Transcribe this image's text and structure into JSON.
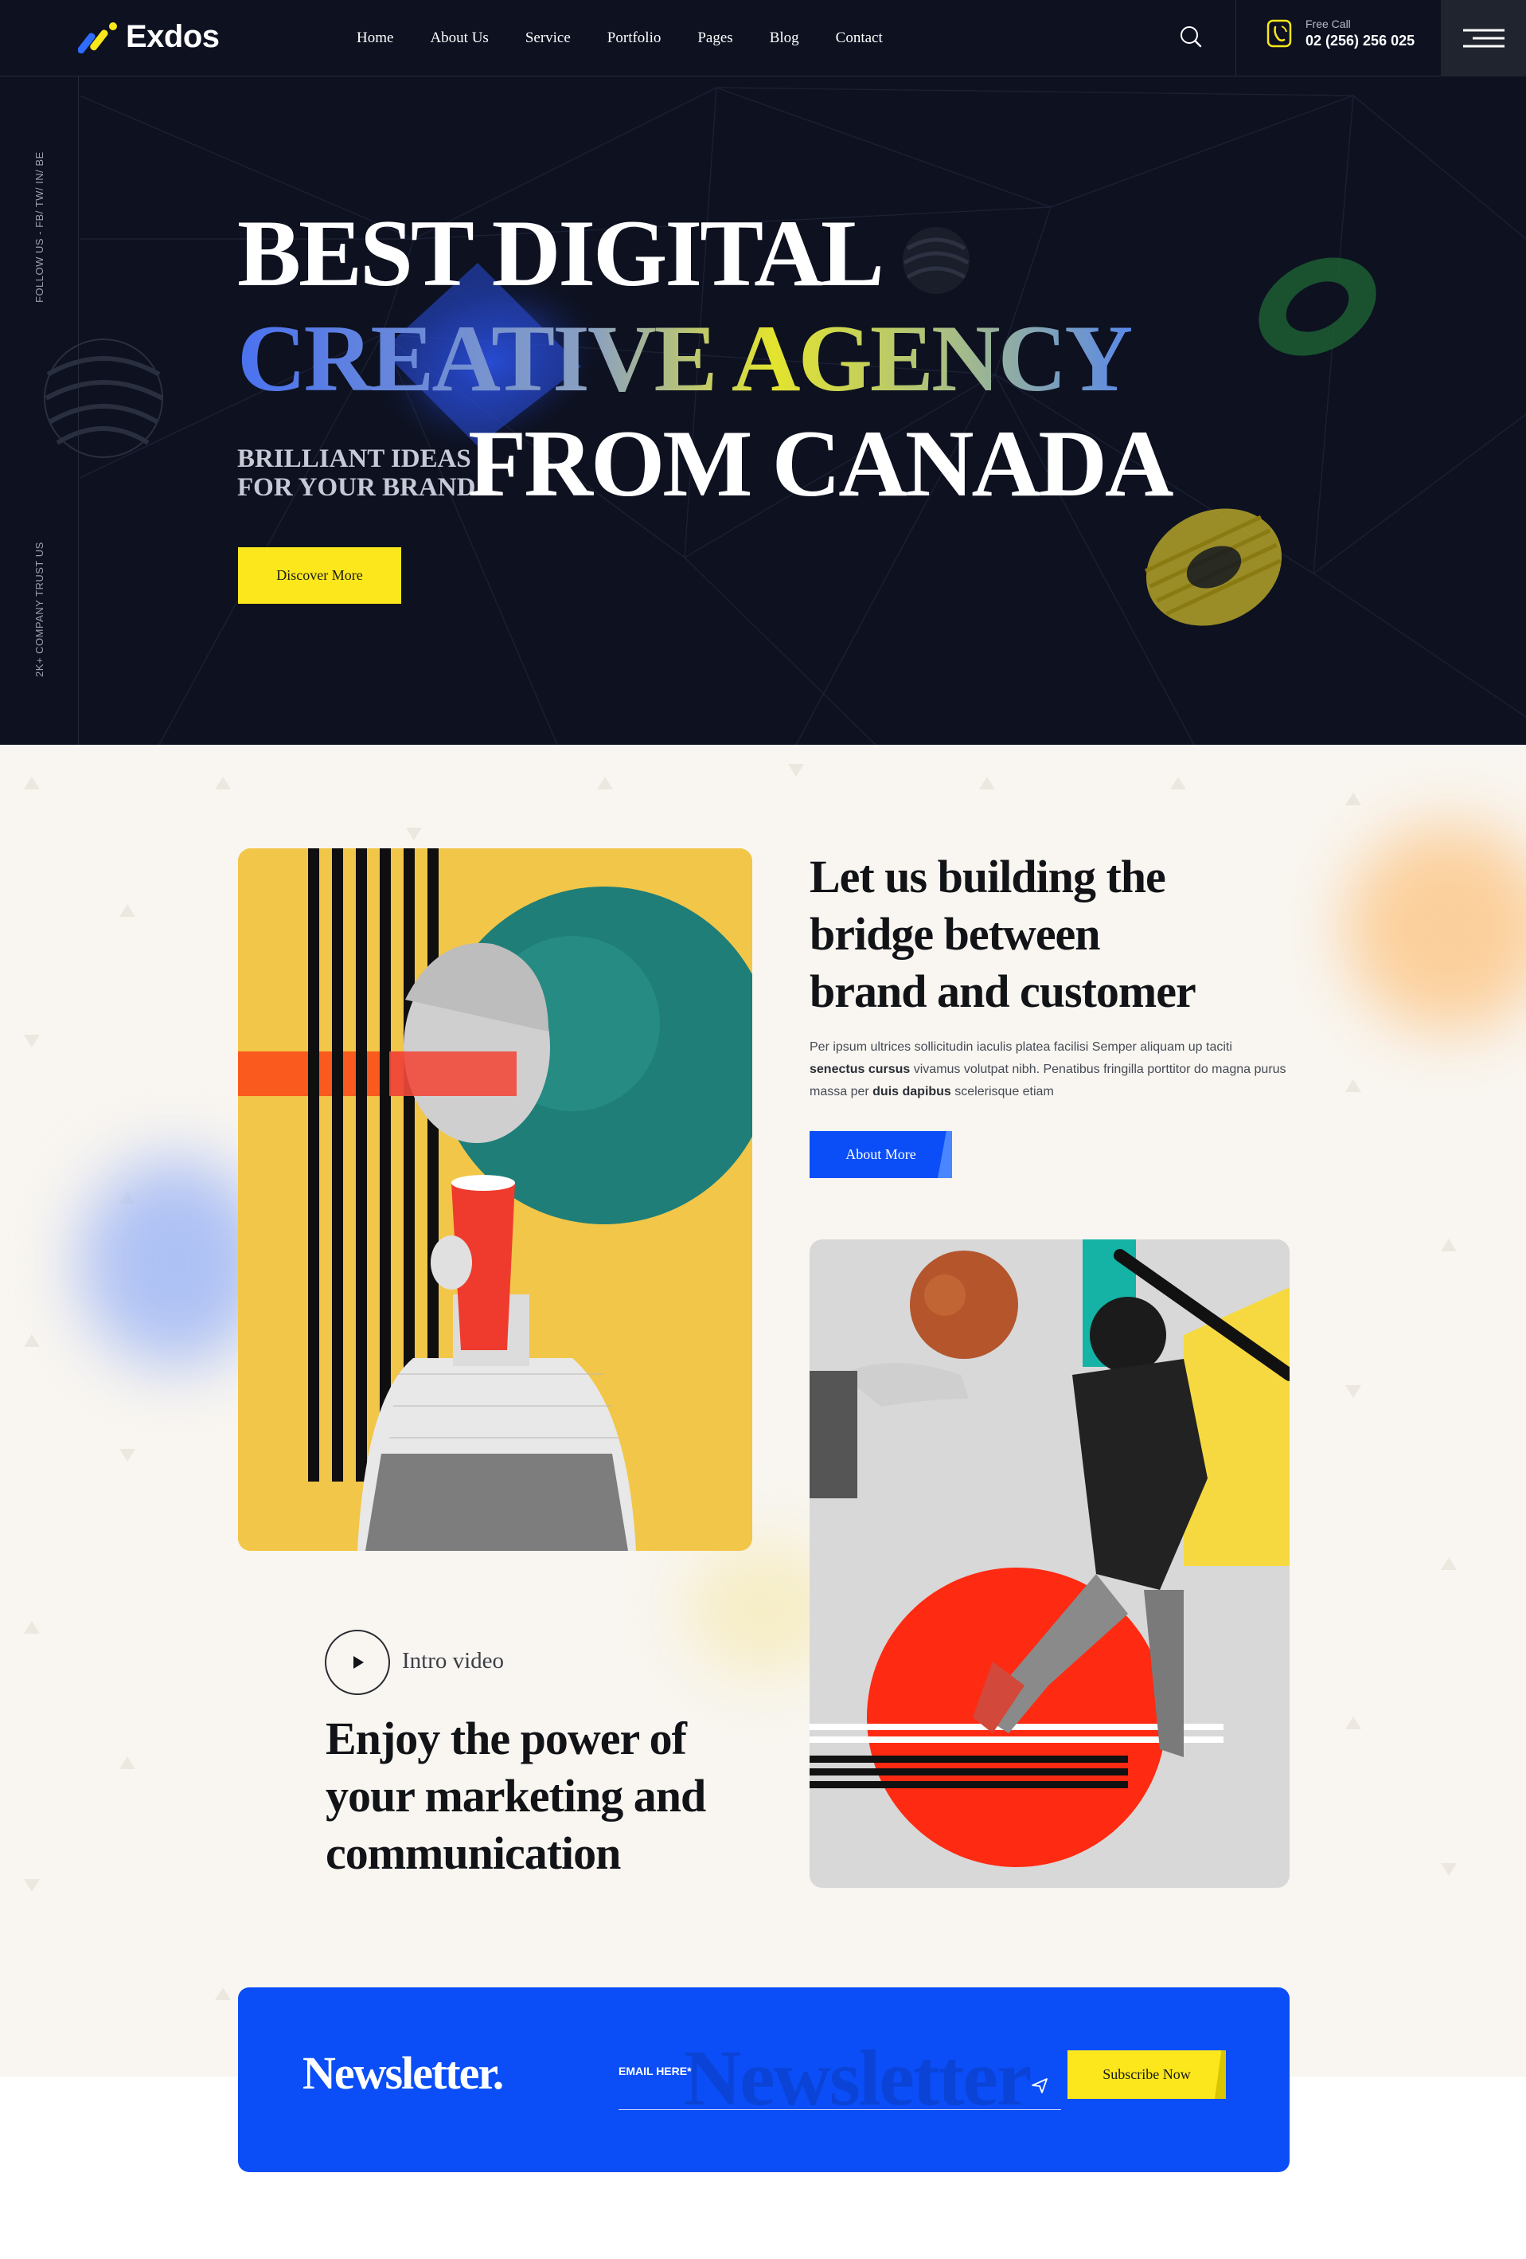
{
  "header": {
    "logo_text": "Exdos",
    "nav": [
      "Home",
      "About Us",
      "Service",
      "Portfolio",
      "Pages",
      "Blog",
      "Contact"
    ],
    "call_label": "Free Call",
    "call_number": "02 (256) 256 025",
    "icons": {
      "search": "search-icon",
      "phone": "phone-icon",
      "menu": "hamburger-menu-icon"
    }
  },
  "sidebar": {
    "follow": "FOLLOW US - FB/ TW/ IN/ BE",
    "trust": "2K+ COMPANY TRUST US"
  },
  "hero": {
    "line1": "BEST DIGITAL",
    "line2": "CREATIVE AGENCY",
    "sub_line1": "BRILLIANT IDEAS",
    "sub_line2": "FOR YOUR BRAND",
    "line3": "FROM CANADA",
    "cta": "Discover More"
  },
  "about": {
    "title_line1": "Let us building the",
    "title_line2": "bridge between",
    "title_line3": "brand and customer",
    "text_part1": "Per ipsum ultrices sollicitudin iaculis platea facilisi Semper aliquam up taciti",
    "text_bold1": "senectus cursus",
    "text_part2": "vivamus volutpat nibh. Penatibus fringilla porttitor do magna purus massa per",
    "text_bold2": "duis dapibus",
    "text_part3": "scelerisque etiam",
    "cta": "About More",
    "video_label": "Intro video",
    "enjoy_line1": "Enjoy the power of",
    "enjoy_line2": "your marketing and",
    "enjoy_line3": "communication"
  },
  "newsletter": {
    "title": "Newsletter.",
    "watermark": "Newsletter",
    "email_label": "EMAIL HERE*",
    "button": "Subscribe Now"
  },
  "colors": {
    "dark": "#0d1120",
    "accent_yellow": "#fbe71b",
    "accent_blue": "#0b4ef7",
    "cream": "#f9f6f1"
  }
}
